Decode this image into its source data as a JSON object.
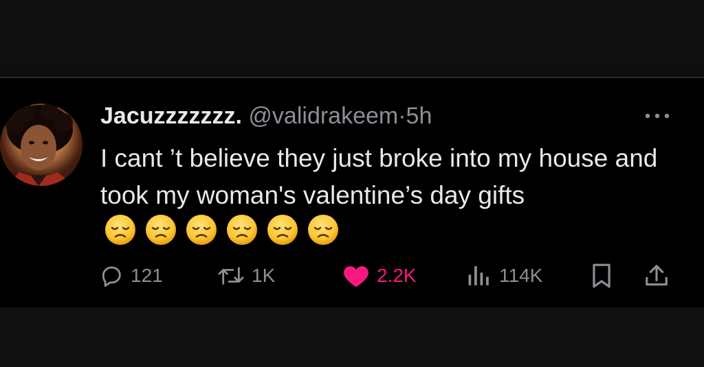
{
  "tweet": {
    "display_name": "Jacuzzzzzzz.",
    "handle": "@validrakeem",
    "separator": "·",
    "time": "5h",
    "text": "I cant ’t believe they just broke into my house and took my woman's valentine’s day gifts",
    "emoji_icon": "disappointed-face-icon",
    "emoji_count": 6
  },
  "actions": {
    "replies": "121",
    "reposts": "1K",
    "likes": "2.2K",
    "views": "114K"
  },
  "colors": {
    "background": "#000000",
    "text": "#e7e9ea",
    "muted": "#8b9096",
    "like": "#f91880"
  },
  "icons": [
    "reply-icon",
    "repost-icon",
    "heart-icon",
    "views-icon",
    "bookmark-icon",
    "share-icon",
    "more-icon"
  ]
}
